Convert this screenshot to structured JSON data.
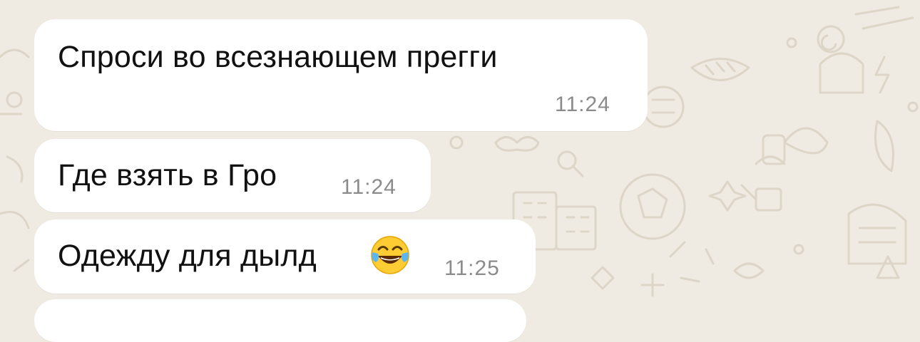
{
  "chat": {
    "messages": [
      {
        "text": "Спроси во всезнающем прегги",
        "time": "11:24"
      },
      {
        "text": "Где взять в Гро",
        "time": "11:24"
      },
      {
        "text": "Одежду для дылд",
        "emoji": "face-with-tears-of-joy",
        "time": "11:25"
      }
    ]
  },
  "colors": {
    "background": "#efeae2",
    "bubble": "#ffffff",
    "text": "#111111",
    "time": "#8b8b8b",
    "doodle": "#ddd5c8"
  }
}
